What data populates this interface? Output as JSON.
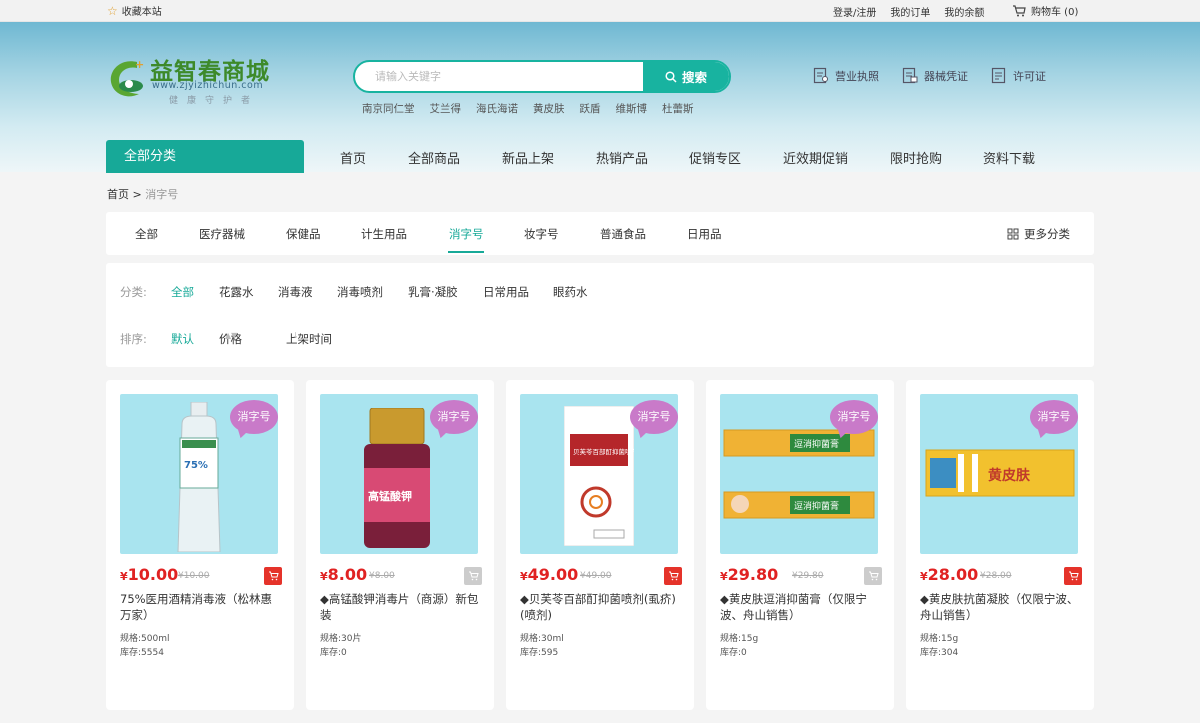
{
  "topbar": {
    "favorite": "收藏本站",
    "links": [
      "登录/注册",
      "我的订单",
      "我的余额"
    ],
    "cart": "购物车 (0)"
  },
  "logo": {
    "title": "益智春商城",
    "url": "www.zjyizhichun.com",
    "motto": "健康守护者"
  },
  "search": {
    "placeholder": "请输入关键字",
    "button": "搜索",
    "hotwords": [
      "南京同仁堂",
      "艾兰得",
      "海氏海诺",
      "黄皮肤",
      "跃盾",
      "维斯博",
      "杜蕾斯"
    ]
  },
  "certs": [
    "营业执照",
    "器械凭证",
    "许可证"
  ],
  "nav": {
    "all_categories": "全部分类",
    "items": [
      "首页",
      "全部商品",
      "新品上架",
      "热销产品",
      "促销专区",
      "近效期促销",
      "限时抢购",
      "资料下载"
    ]
  },
  "breadcrumb": {
    "home": "首页",
    "sep": ">",
    "current": "消字号"
  },
  "tabs": {
    "items": [
      "全部",
      "医疗器械",
      "保健品",
      "计生用品",
      "消字号",
      "妆字号",
      "普通食品",
      "日用品"
    ],
    "active": "消字号",
    "more": "更多分类"
  },
  "filter": {
    "category_label": "分类:",
    "categories": [
      "全部",
      "花露水",
      "消毒液",
      "消毒喷剂",
      "乳膏·凝胶",
      "日常用品",
      "眼药水"
    ],
    "sort_label": "排序:",
    "sorts": [
      "默认",
      "价格",
      "上架时间"
    ]
  },
  "products": [
    {
      "badge": "消字号",
      "price_symbol": "¥",
      "price": "10.00",
      "old_price": "¥10.00",
      "name": "75%医用酒精消毒液（松林惠万家）",
      "spec": "规格:500ml",
      "stock": "库存:5554",
      "cart_active": true
    },
    {
      "badge": "消字号",
      "price_symbol": "¥",
      "price": "8.00",
      "old_price": "¥8.00",
      "name": "◆高锰酸钾消毒片（商源）新包装",
      "spec": "规格:30片",
      "stock": "库存:0",
      "cart_active": false
    },
    {
      "badge": "消字号",
      "price_symbol": "¥",
      "price": "49.00",
      "old_price": "¥49.00",
      "name": "◆贝芙苓百部酊抑菌喷剂(虱疥)(喷剂)",
      "spec": "规格:30ml",
      "stock": "库存:595",
      "cart_active": true
    },
    {
      "badge": "消字号",
      "price_symbol": "¥",
      "price": "29.80",
      "old_price": "¥29.80",
      "name": "◆黄皮肤逗消抑菌膏（仅限宁波、舟山销售）",
      "spec": "规格:15g",
      "stock": "库存:0",
      "cart_active": false
    },
    {
      "badge": "消字号",
      "price_symbol": "¥",
      "price": "28.00",
      "old_price": "¥28.00",
      "name": "◆黄皮肤抗菌凝胶（仅限宁波、舟山销售）",
      "spec": "规格:15g",
      "stock": "库存:304",
      "cart_active": true
    }
  ],
  "product_art": {
    "bottle_label": "75%",
    "jar_label": "高锰酸钾",
    "box_label": "贝芙苓百部酊抑菌喷剂",
    "tube_label": "逗消抑菌膏",
    "tube_brand": "黄皮肤"
  },
  "colors": {
    "accent": "#17a998",
    "price": "#e02222",
    "badge": "#c97ac9",
    "image_bg": "#a9e4ef"
  }
}
